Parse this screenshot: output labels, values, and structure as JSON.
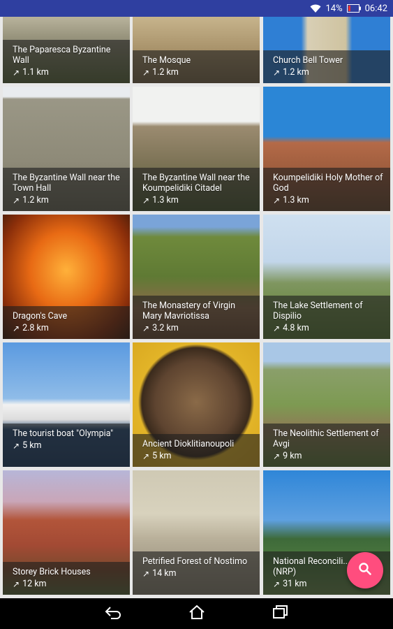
{
  "status_bar": {
    "battery": "14%",
    "time": "06:42",
    "icons": [
      "wifi-icon",
      "battery-icon"
    ]
  },
  "tiles": [
    {
      "title": "The Paparesca Byzantine Wall",
      "distance": "1.1 km"
    },
    {
      "title": "The Mosque",
      "distance": "1.2 km"
    },
    {
      "title": "Church Bell Tower",
      "distance": "1.2 km"
    },
    {
      "title": "The Byzantine Wall near the Town Hall",
      "distance": "1.2 km"
    },
    {
      "title": "The Byzantine  Wall near the Koumpelidiki Citadel",
      "distance": "1.3 km"
    },
    {
      "title": "Koumpelidiki Holy Mother of God",
      "distance": "1.3 km"
    },
    {
      "title": "Dragon's Cave",
      "distance": "2.8 km"
    },
    {
      "title": "The Monastery of Virgin Mary Mavriotissa",
      "distance": "3.2 km"
    },
    {
      "title": "The Lake Settlement of Dispilio",
      "distance": "4.8 km"
    },
    {
      "title": "The tourist boat \"Olympia\"",
      "distance": "5 km"
    },
    {
      "title": "Ancient Dioklitianoupoli",
      "distance": "5 km"
    },
    {
      "title": "The Neolithic Settlement of Avgi",
      "distance": "9 km"
    },
    {
      "title": "Storey Brick Houses",
      "distance": "12 km"
    },
    {
      "title": "Petrified Forest of Nostimo",
      "distance": "14 km"
    },
    {
      "title": "National Reconcili... Park (NRP)",
      "distance": "31 km"
    }
  ],
  "fab": {
    "icon": "search-icon",
    "color": "#ff4d7e"
  },
  "nav": {
    "icons": [
      "back-icon",
      "home-icon",
      "recent-apps-icon"
    ]
  },
  "colors": {
    "status_bar": "#2f3fa0",
    "accent": "#ff4d7e"
  }
}
